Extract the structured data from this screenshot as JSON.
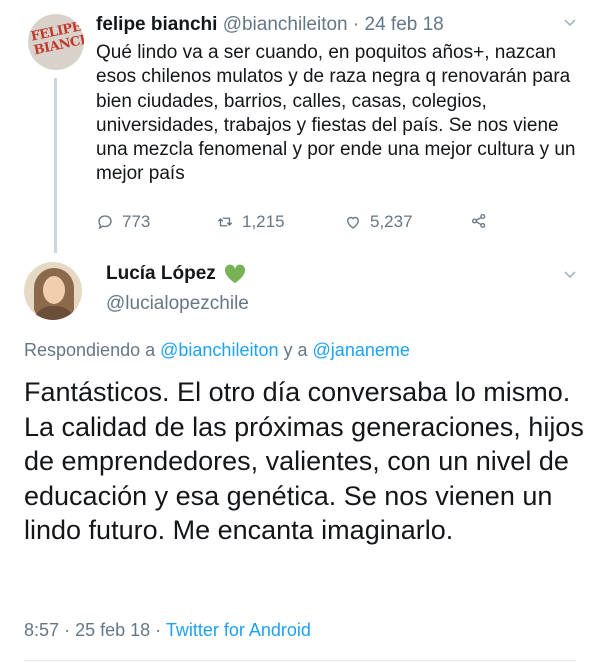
{
  "tweet1": {
    "avatar_text": "FELIPE BIANCHI",
    "name": "felipe bianchi",
    "handle": "@bianchileiton",
    "date": "24 feb 18",
    "separator": "·",
    "text": "Qué lindo va a ser cuando, en poquitos años+, nazcan esos chilenos mulatos y de raza negra q renovarán para bien ciudades, barrios, calles, casas, colegios, universidades, trabajos y fiestas del país. Se nos viene una mezcla fenomenal y por ende una mejor cultura y un mejor país",
    "replies": "773",
    "retweets": "1,215",
    "likes": "5,237"
  },
  "tweet2": {
    "name": "Lucía López",
    "name_emoji": "green-heart",
    "handle": "@lucialopezchile",
    "replying_prefix": "Respondiendo a",
    "replying_to_1": "@bianchileiton",
    "replying_joiner": "y a",
    "replying_to_2": "@jananeme",
    "text": "Fantásticos. El otro día conversaba lo mismo. La calidad de las próximas generaciones, hijos de emprendedores, valientes, con un nivel de educación y esa genética. Se nos vienen un lindo futuro. Me encanta imaginarlo.",
    "time": "8:57",
    "date": "25 feb 18",
    "source": "Twitter for Android",
    "separator": "·"
  },
  "colors": {
    "text": "#14171a",
    "secondary": "#657786",
    "link": "#1da1f2",
    "heart": "#77b255"
  }
}
